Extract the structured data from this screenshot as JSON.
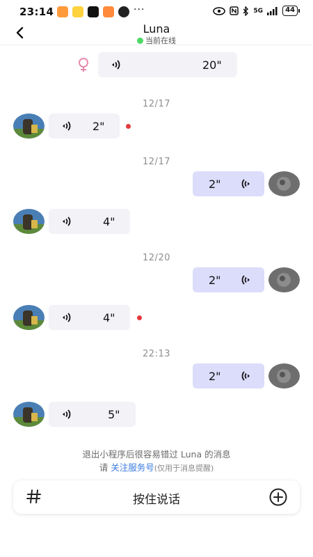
{
  "status_bar": {
    "time": "23:14",
    "dots": "···",
    "network": "5G",
    "battery": "44"
  },
  "header": {
    "title": "Luna",
    "status": "当前在线"
  },
  "messages": [
    {
      "type": "sent-top",
      "duration": "20\""
    },
    {
      "type": "time",
      "text": "12/17"
    },
    {
      "type": "received",
      "duration": "2\"",
      "unread": true
    },
    {
      "type": "time",
      "text": "12/17"
    },
    {
      "type": "sent",
      "duration": "2\""
    },
    {
      "type": "received",
      "duration": "4\"",
      "unread": false
    },
    {
      "type": "time",
      "text": "12/20"
    },
    {
      "type": "sent",
      "duration": "2\""
    },
    {
      "type": "received",
      "duration": "4\"",
      "unread": true
    },
    {
      "type": "time",
      "text": "22:13"
    },
    {
      "type": "sent",
      "duration": "2\""
    },
    {
      "type": "received",
      "duration": "5\"",
      "unread": false
    }
  ],
  "notice": {
    "line1": "退出小程序后很容易错过 Luna 的消息",
    "prefix": "请 ",
    "link": "关注服务号",
    "suffix": "(仅用于消息提醒)"
  },
  "input_bar": {
    "hold_to_talk": "按住说话"
  },
  "colors": {
    "received_bubble": "#f2f2f7",
    "sent_bubble": "#dcdcfb",
    "unread_dot": "#e5393b",
    "online_dot": "#4cd964",
    "link": "#3a7be0"
  }
}
